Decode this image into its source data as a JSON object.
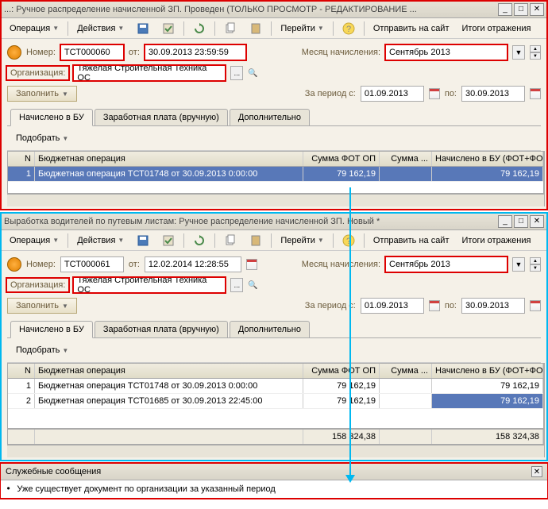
{
  "win1": {
    "title": "...: Ручное распределение начисленной ЗП. Проведен (ТОЛЬКО ПРОСМОТР - РЕДАКТИРОВАНИЕ ...",
    "toolbar": {
      "operation": "Операция",
      "actions": "Действия",
      "goto": "Перейти",
      "send": "Отправить на сайт",
      "results": "Итоги отражения"
    },
    "nomer_lbl": "Номер:",
    "nomer": "ТСТ000060",
    "ot_lbl": "от:",
    "ot": "30.09.2013 23:59:59",
    "month_lbl": "Месяц начисления:",
    "month": "Сентябрь 2013",
    "org_lbl": "Организация:",
    "org": "Тяжелая Строительная Техника ОС",
    "fill": "Заполнить",
    "period_lbl": "За период с:",
    "period_from": "01.09.2013",
    "period_to_lbl": "по:",
    "period_to": "30.09.2013",
    "tabs": [
      "Начислено в БУ",
      "Заработная плата (вручную)",
      "Дополнительно"
    ],
    "pick": "Подобрать",
    "grid": {
      "headers": [
        "N",
        "Бюджетная операция",
        "Сумма ФОТ ОП",
        "Сумма ...",
        "Начислено в БУ (ФОТ+ФОБ)"
      ],
      "rows": [
        {
          "n": "1",
          "op": "Бюджетная операция ТСТ01748 от 30.09.2013 0:00:00",
          "fot": "79 162,19",
          "sum": "",
          "last": "79 162,19"
        }
      ]
    }
  },
  "win2": {
    "title": "Выработка водителей по путевым листам: Ручное распределение начисленной ЗП. Новый *",
    "toolbar": {
      "operation": "Операция",
      "actions": "Действия",
      "goto": "Перейти",
      "send": "Отправить на сайт",
      "results": "Итоги отражения"
    },
    "nomer_lbl": "Номер:",
    "nomer": "ТСТ000061",
    "ot_lbl": "от:",
    "ot": "12.02.2014 12:28:55",
    "month_lbl": "Месяц начисления:",
    "month": "Сентябрь 2013",
    "org_lbl": "Организация:",
    "org": "Тяжелая Строительная Техника ОС",
    "fill": "Заполнить",
    "period_lbl": "За период с:",
    "period_from": "01.09.2013",
    "period_to_lbl": "по:",
    "period_to": "30.09.2013",
    "tabs": [
      "Начислено в БУ",
      "Заработная плата (вручную)",
      "Дополнительно"
    ],
    "pick": "Подобрать",
    "grid": {
      "headers": [
        "N",
        "Бюджетная операция",
        "Сумма ФОТ ОП",
        "Сумма ...",
        "Начислено в БУ (ФОТ+ФОБ)"
      ],
      "rows": [
        {
          "n": "1",
          "op": "Бюджетная операция ТСТ01748 от 30.09.2013 0:00:00",
          "fot": "79 162,19",
          "sum": "",
          "last": "79 162,19"
        },
        {
          "n": "2",
          "op": "Бюджетная операция ТСТ01685 от 30.09.2013 22:45:00",
          "fot": "79 162,19",
          "sum": "",
          "last": "79 162,19"
        }
      ],
      "footer": {
        "fot": "158 324,38",
        "sum": "",
        "last": "158 324,38"
      }
    }
  },
  "msg": {
    "title": "Служебные сообщения",
    "text": "Уже существует документ по организации за указанный период"
  }
}
